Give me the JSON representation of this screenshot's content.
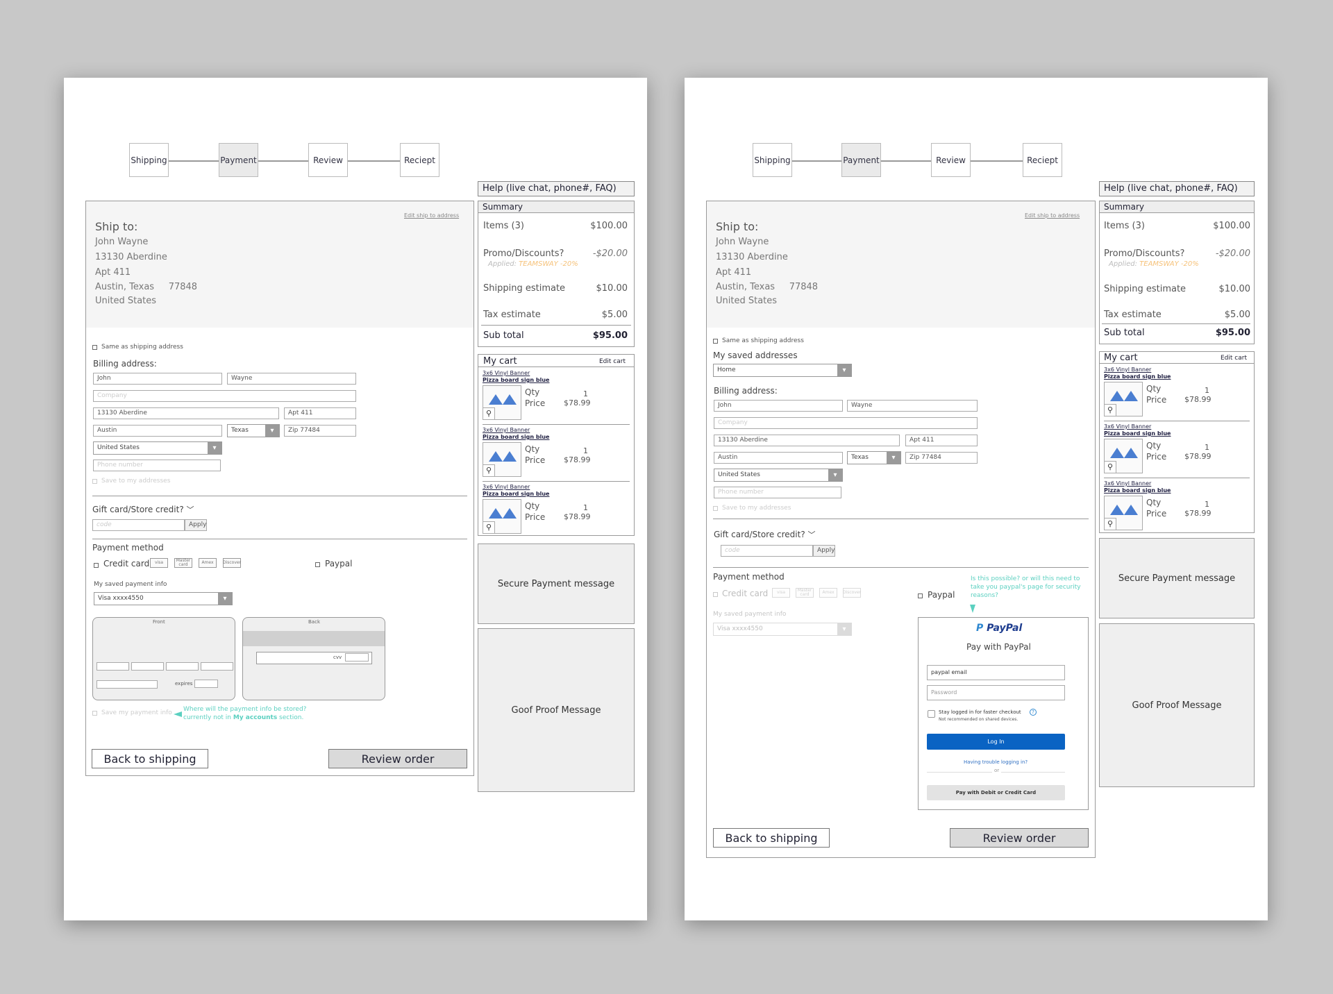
{
  "steps": [
    "Shipping",
    "Payment",
    "Review",
    "Reciept"
  ],
  "help": "Help (live chat, phone#, FAQ)",
  "ship": {
    "title": "Ship to:",
    "edit": "Edit ship to address",
    "lines": [
      "John Wayne",
      "13130 Aberdine",
      "Apt 411",
      "Austin, Texas     77848",
      "United States"
    ]
  },
  "summary": {
    "title": "Summary",
    "items_label": "Items (3)",
    "items_value": "$100.00",
    "promo_label": "Promo/Discounts?",
    "promo_value": "-$20.00",
    "applied": "Applied:",
    "applied_code": "TEAMSWAY  -20%",
    "ship_label": "Shipping estimate",
    "ship_value": "$10.00",
    "tax_label": "Tax estimate",
    "tax_value": "$5.00",
    "subtotal_label": "Sub total",
    "subtotal_value": "$95.00"
  },
  "cart": {
    "title": "My cart",
    "edit": "Edit cart",
    "item": {
      "name": "3x6 Vinyl Banner",
      "variant": "Pizza board sign blue",
      "qty_label": "Qty",
      "qty": "1",
      "price_label": "Price",
      "price": "$78.99"
    }
  },
  "billing": {
    "same": "Same as shipping address",
    "saved_addresses": "My saved addresses",
    "saved_address_value": "Home",
    "title": "Billing address:",
    "first": "John",
    "last": "Wayne",
    "company": "Company",
    "street": "13130 Aberdine",
    "apt": "Apt 411",
    "city": "Austin",
    "state": "Texas",
    "zip": "Zip 77484",
    "country": "United States",
    "phone": "Phone number",
    "save": "Save to my addresses"
  },
  "gift": {
    "title": "Gift card/Store credit?",
    "placeholder": "code",
    "apply": "Apply"
  },
  "payment": {
    "title": "Payment method",
    "credit": "Credit card",
    "logos": [
      "visa",
      "Master card",
      "Amex",
      "Discover"
    ],
    "paypal": "Paypal",
    "saved": "My saved payment info",
    "saved_value": "Visa xxxx4550",
    "front": "Front",
    "back": "Back",
    "expires": "expires",
    "cvv": "cvv",
    "save": "Save my payment info",
    "note1": "Where will the payment info be stored?",
    "note2a": "currently not in ",
    "note2b": "My accounts",
    "note2c": " section.",
    "paypal_note": [
      "Is this possible? or will this need to",
      "take you paypal's page for security",
      "reasons?"
    ]
  },
  "paypal": {
    "logo": "PayPal",
    "heading": "Pay with PayPal",
    "email": "paypal email",
    "password": "Password",
    "stay": "Stay logged in for faster checkout",
    "stay_sub": "Not recommended on shared devices.",
    "login": "Log In",
    "trouble": "Having trouble logging in?",
    "or": "or",
    "card": "Pay with Debit or Credit Card"
  },
  "buttons": {
    "back": "Back to shipping",
    "review": "Review order"
  },
  "secure": "Secure Payment message",
  "goof": "Goof Proof Message"
}
